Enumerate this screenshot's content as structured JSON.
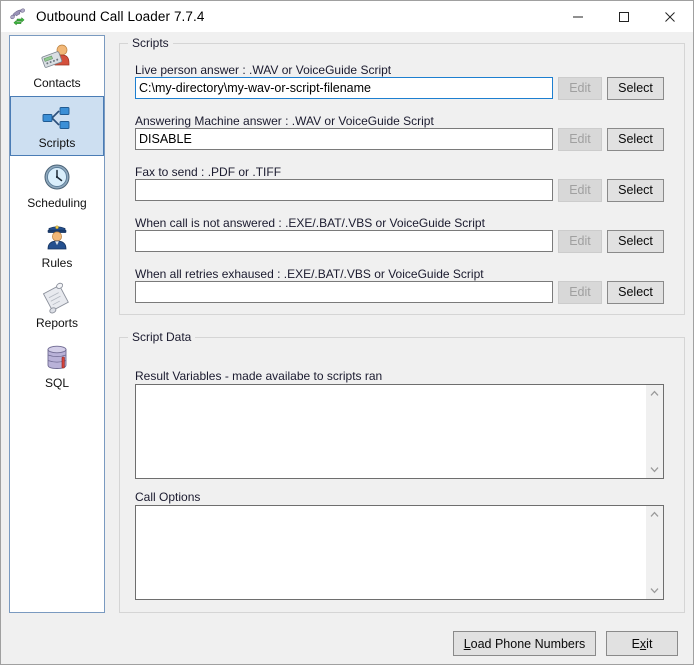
{
  "window": {
    "title": "Outbound Call Loader 7.7.4",
    "icon": "phone-sync-icon",
    "controls": {
      "minimize": "minimize-icon",
      "maximize": "maximize-icon",
      "close": "close-icon"
    }
  },
  "sidebar": {
    "items": [
      {
        "label": "Contacts",
        "icon": "contacts-icon",
        "selected": false
      },
      {
        "label": "Scripts",
        "icon": "scripts-icon",
        "selected": true
      },
      {
        "label": "Scheduling",
        "icon": "clock-icon",
        "selected": false
      },
      {
        "label": "Rules",
        "icon": "officer-icon",
        "selected": false
      },
      {
        "label": "Reports",
        "icon": "scroll-icon",
        "selected": false
      },
      {
        "label": "SQL",
        "icon": "database-icon",
        "selected": false
      }
    ]
  },
  "scripts_group": {
    "title": "Scripts",
    "fields": [
      {
        "label": "Live person answer : .WAV or VoiceGuide Script",
        "value": "C:\\my-directory\\my-wav-or-script-filename",
        "placeholder": "",
        "focused": true,
        "edit_label": "Edit",
        "edit_enabled": false,
        "select_label": "Select",
        "select_enabled": true
      },
      {
        "label": "Answering Machine answer : .WAV or VoiceGuide Script",
        "value": "DISABLE",
        "placeholder": "",
        "focused": false,
        "edit_label": "Edit",
        "edit_enabled": false,
        "select_label": "Select",
        "select_enabled": true
      },
      {
        "label": "Fax to send : .PDF or .TIFF",
        "value": "",
        "placeholder": "",
        "focused": false,
        "edit_label": "Edit",
        "edit_enabled": false,
        "select_label": "Select",
        "select_enabled": true
      },
      {
        "label": "When call is not answered : .EXE/.BAT/.VBS or VoiceGuide Script",
        "value": "",
        "placeholder": "",
        "focused": false,
        "edit_label": "Edit",
        "edit_enabled": false,
        "select_label": "Select",
        "select_enabled": true
      },
      {
        "label": "When all retries exhaused : .EXE/.BAT/.VBS or VoiceGuide Script",
        "value": "",
        "placeholder": "",
        "focused": false,
        "edit_label": "Edit",
        "edit_enabled": false,
        "select_label": "Select",
        "select_enabled": true
      }
    ]
  },
  "script_data_group": {
    "title": "Script Data",
    "result_variables": {
      "label": "Result Variables - made availabe to scripts ran",
      "value": "",
      "placeholder": "",
      "scroll_up": "scroll-up-icon",
      "scroll_down": "scroll-down-icon"
    },
    "call_options": {
      "label": "Call Options",
      "value": "",
      "placeholder": "",
      "scroll_up": "scroll-up-icon",
      "scroll_down": "scroll-down-icon"
    }
  },
  "footer": {
    "load_phone_numbers": {
      "accel": "L",
      "rest": "oad Phone Numbers"
    },
    "exit": {
      "pre": "E",
      "accel": "x",
      "rest": "it"
    }
  },
  "colors": {
    "window_bg": "#f0f0f0",
    "selection_bg": "#cddff1",
    "selection_border": "#4a7cb5",
    "focus_border": "#1d7fd0",
    "field_border": "#7a7a7a",
    "group_border": "#d5d5d5"
  }
}
